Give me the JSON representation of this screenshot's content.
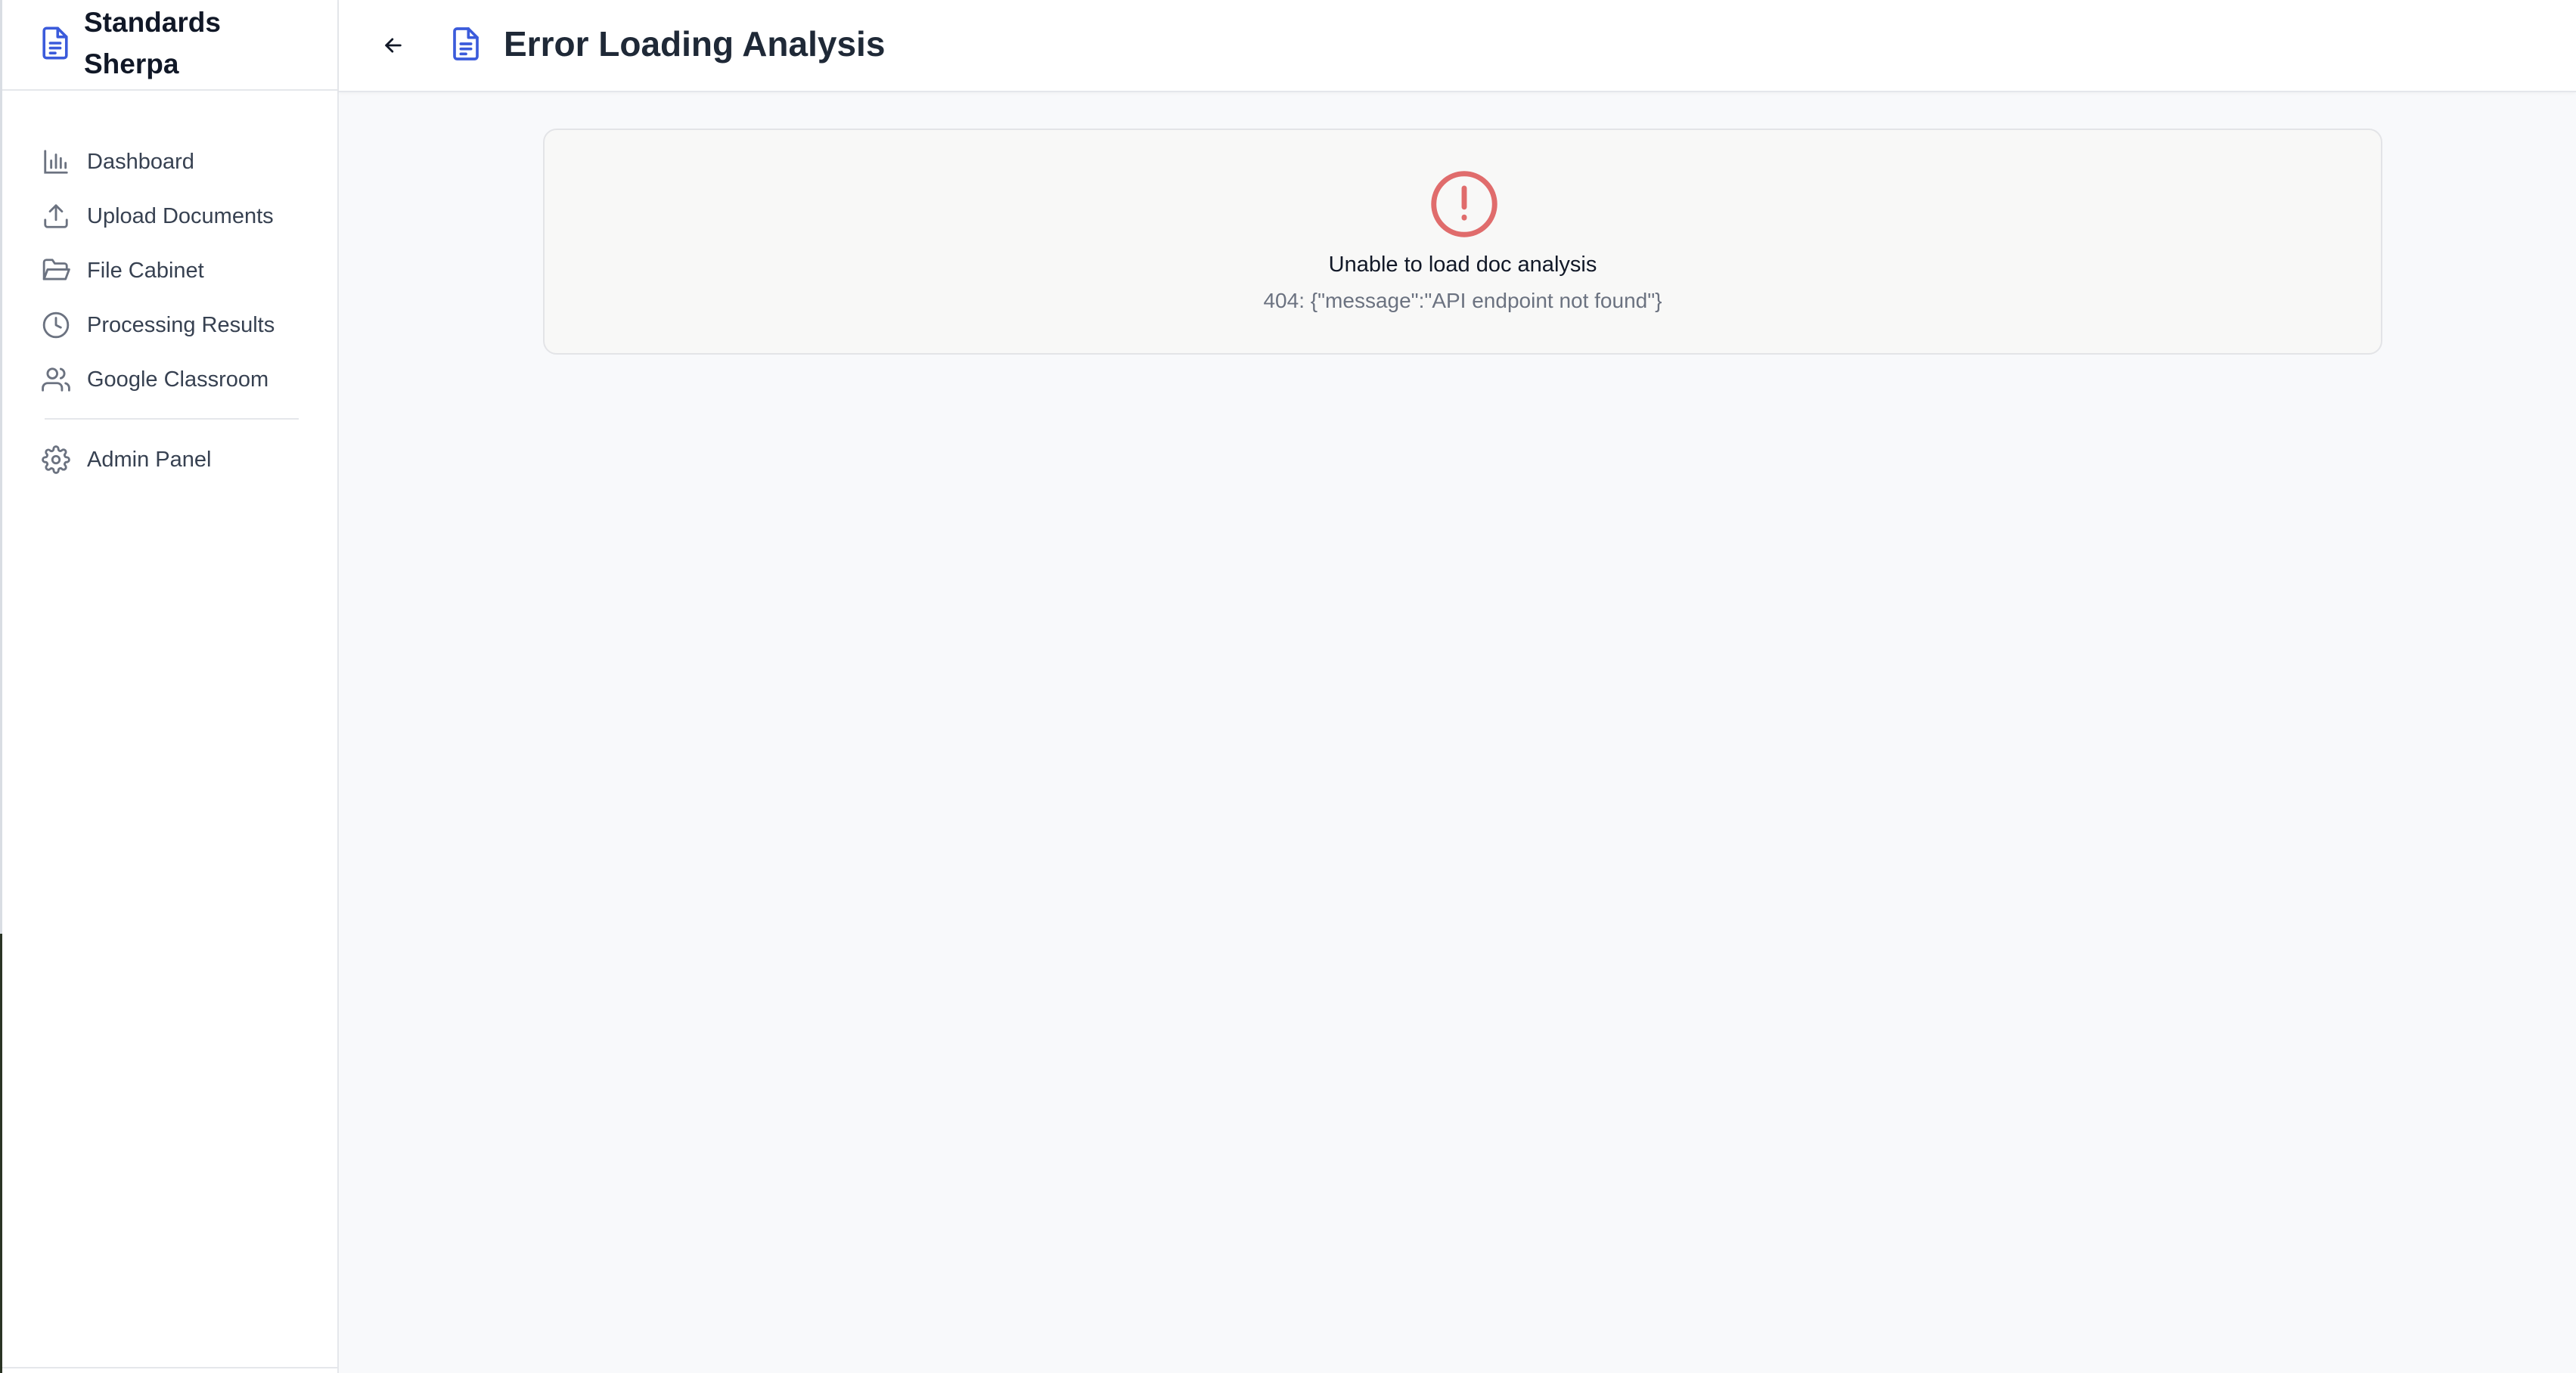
{
  "sidebar": {
    "brand": {
      "line1": "Standards",
      "line2": "Sherpa",
      "icon": "document-icon"
    },
    "items": [
      {
        "label": "Dashboard",
        "icon": "bar-chart-icon"
      },
      {
        "label": "Upload Documents",
        "icon": "upload-icon"
      },
      {
        "label": "File Cabinet",
        "icon": "folder-open-icon"
      },
      {
        "label": "Processing Results",
        "icon": "clock-icon"
      },
      {
        "label": "Google Classroom",
        "icon": "users-icon"
      }
    ],
    "admin": {
      "label": "Admin Panel",
      "icon": "gear-icon"
    }
  },
  "header": {
    "title": "Error Loading Analysis",
    "back_icon": "arrow-left-icon",
    "title_icon": "document-icon"
  },
  "error": {
    "title": "Unable to load doc analysis",
    "detail": "404: {\"message\":\"API endpoint not found\"}",
    "icon": "alert-circle-icon"
  },
  "colors": {
    "accent": "#3b5bdb",
    "error": "#e06c6c",
    "icon_gray": "#6b7280"
  }
}
